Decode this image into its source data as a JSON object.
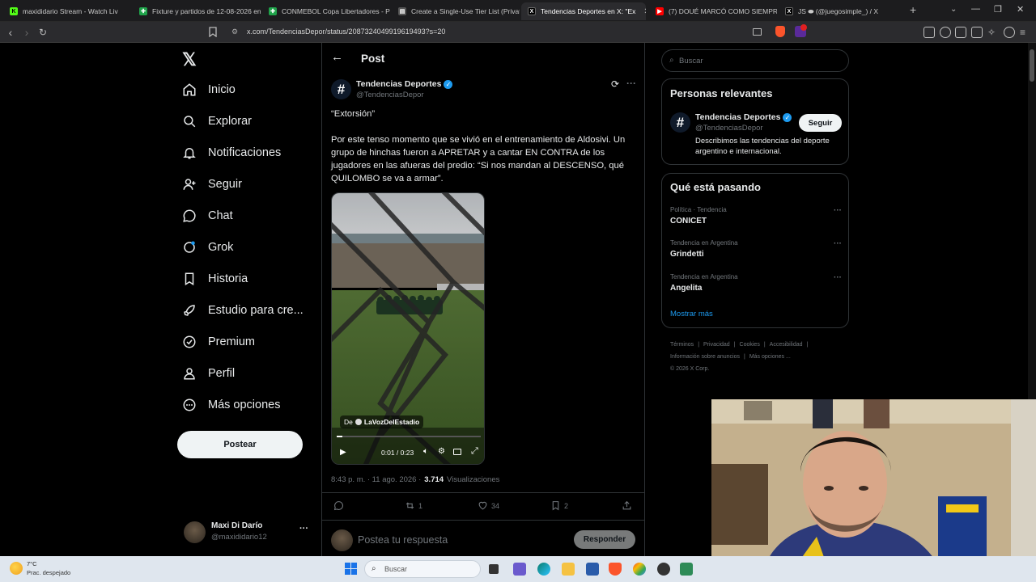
{
  "browser": {
    "tabs": [
      {
        "title": "maxididario Stream - Watch Liv",
        "color": "#53fc18",
        "glyph": "K"
      },
      {
        "title": "Fixture y partidos de 12-08-2026 en",
        "color": "#1fa34a",
        "glyph": "✚"
      },
      {
        "title": "CONMEBOL Copa Libertadores - PC",
        "color": "#1fa34a",
        "glyph": "✚"
      },
      {
        "title": "Create a Single-Use Tier List (Privat",
        "color": "#444444",
        "glyph": "▤"
      },
      {
        "title": "Tendencias Deportes en X: \"Ex",
        "color": "#000000",
        "glyph": "X"
      },
      {
        "title": "(7) DOUÉ MARCÓ COMO SIEMPRE",
        "color": "#ff0000",
        "glyph": "▶"
      },
      {
        "title": "JS ⬬ (@juegosimple_) / X",
        "color": "#000000",
        "glyph": "X"
      }
    ],
    "url": "x.com/TendenciasDepor/status/2087324049919619493?s=20",
    "new_tab": "+"
  },
  "nav": {
    "logo": "𝕏",
    "items": [
      {
        "label": "Inicio",
        "icon": "home-icon"
      },
      {
        "label": "Explorar",
        "icon": "search-icon"
      },
      {
        "label": "Notificaciones",
        "icon": "bell-icon"
      },
      {
        "label": "Seguir",
        "icon": "follow-icon"
      },
      {
        "label": "Chat",
        "icon": "chat-icon"
      },
      {
        "label": "Grok",
        "icon": "grok-icon"
      },
      {
        "label": "Historia",
        "icon": "bookmark-icon"
      },
      {
        "label": "Estudio para cre...",
        "icon": "rocket-icon"
      },
      {
        "label": "Premium",
        "icon": "premium-icon"
      },
      {
        "label": "Perfil",
        "icon": "person-icon"
      },
      {
        "label": "Más opciones",
        "icon": "more-circle-icon"
      }
    ],
    "post_button": "Postear",
    "account": {
      "name": "Maxi Di Darío",
      "handle": "@maxididario12",
      "more": "···"
    }
  },
  "main": {
    "header": "Post",
    "author": {
      "name": "Tendencias Deportes",
      "handle": "@TendenciasDepor"
    },
    "text_title": "“Extorsión”",
    "text_body": "Por este tenso momento que se vivió en el entrenamiento de Aldosivi. Un grupo de hinchas fueron a APRETAR y a cantar EN CONTRA de los jugadores en las afueras del predio: “Si nos mandan al DESCENSO, qué QUILOMBO se va a armar”.",
    "video": {
      "source_prefix": "De",
      "source": "LaVozDelEstadio",
      "time": "0:01 / 0:23",
      "progress": 0.04
    },
    "meta": {
      "time": "8:43 p. m. · 11 ago. 2026 ·",
      "views": "3.714",
      "views_label": "Visualizaciones"
    },
    "actions": {
      "replies": "",
      "reposts": "1",
      "likes": "34",
      "bookmarks": "2"
    },
    "reply": {
      "placeholder": "Postea tu respuesta",
      "button": "Responder"
    }
  },
  "right": {
    "search_placeholder": "Buscar",
    "relevant": {
      "title": "Personas relevantes",
      "name": "Tendencias Deportes",
      "handle": "@TendenciasDepor",
      "follow": "Seguir",
      "bio": "Describimos las tendencias del deporte argentino e internacional."
    },
    "trends": {
      "title": "Qué está pasando",
      "items": [
        {
          "context": "Política · Tendencia",
          "topic": "CONICET"
        },
        {
          "context": "Tendencia en Argentina",
          "topic": "Grindetti"
        },
        {
          "context": "Tendencia en Argentina",
          "topic": "Angelita"
        }
      ],
      "more": "Mostrar más"
    },
    "footer": {
      "line1": [
        "Términos",
        "Privacidad",
        "Cookies",
        "Accesibilidad"
      ],
      "line2": [
        "Información sobre anuncios",
        "Más opciones ..."
      ],
      "copyright": "© 2026 X Corp."
    }
  },
  "taskbar": {
    "weather_temp": "7°C",
    "weather_desc": "Prac. despejado",
    "search": "Buscar"
  },
  "colors": {
    "verified": "#1d9bf0",
    "accent": "#1d9bf0"
  }
}
